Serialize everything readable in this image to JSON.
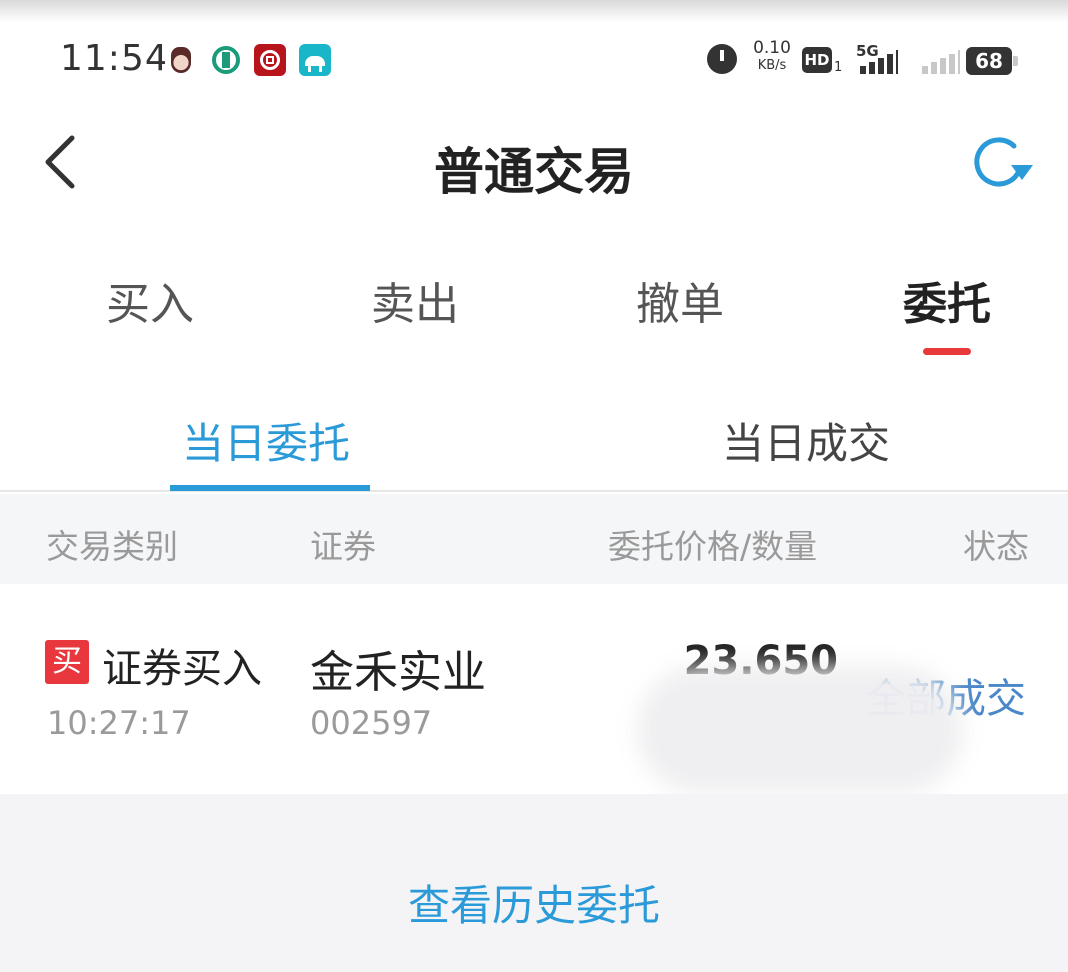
{
  "status_bar": {
    "time": "11:54",
    "net_speed_value": "0.10",
    "net_speed_unit": "KB/s",
    "hd_label": "HD",
    "hd_sub": "1",
    "network_type": "5G",
    "battery": "68"
  },
  "header": {
    "title": "普通交易",
    "back_icon": "chevron-left-icon",
    "refresh_icon": "refresh-icon"
  },
  "main_tabs": [
    {
      "label": "买入",
      "active": false
    },
    {
      "label": "卖出",
      "active": false
    },
    {
      "label": "撤单",
      "active": false
    },
    {
      "label": "委托",
      "active": true
    }
  ],
  "sub_tabs": [
    {
      "label": "当日委托",
      "active": true
    },
    {
      "label": "当日成交",
      "active": false
    }
  ],
  "table": {
    "columns": [
      "交易类别",
      "证券",
      "委托价格/数量",
      "状态"
    ],
    "rows": [
      {
        "badge": "买",
        "type": "证券买入",
        "time": "10:27:17",
        "name": "金禾实业",
        "code": "002597",
        "price": "23.650",
        "status": "全部成交"
      }
    ]
  },
  "footer": {
    "history_link": "查看历史委托"
  },
  "colors": {
    "accent_blue": "#2a9ad8",
    "tab_indicator_red": "#e83a3a",
    "buy_badge_red": "#e8373d",
    "status_blue": "#4a87c8"
  }
}
